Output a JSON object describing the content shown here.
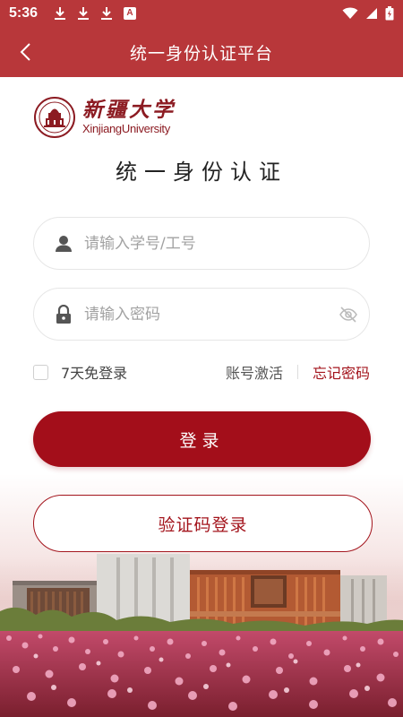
{
  "status_bar": {
    "time": "5:36",
    "badge": "A",
    "left_icons": [
      "download-icon",
      "download-icon",
      "download-icon",
      "a-badge-icon"
    ],
    "right_icons": [
      "wifi-icon",
      "signal-icon",
      "battery-charging-icon"
    ]
  },
  "header": {
    "title": "统一身份认证平台",
    "back_icon": "chevron-left-icon"
  },
  "logo": {
    "cn": "新疆大学",
    "en": "XinjiangUniversity"
  },
  "heading": "统一身份认证",
  "form": {
    "username_placeholder": "请输入学号/工号",
    "password_placeholder": "请输入密码",
    "remember_label": "7天免登录",
    "activate_label": "账号激活",
    "forgot_label": "忘记密码",
    "login_label": "登录",
    "sms_login_label": "验证码登录"
  },
  "colors": {
    "primary": "#a30e1a",
    "header": "#b8373a",
    "link": "#a3141c"
  }
}
